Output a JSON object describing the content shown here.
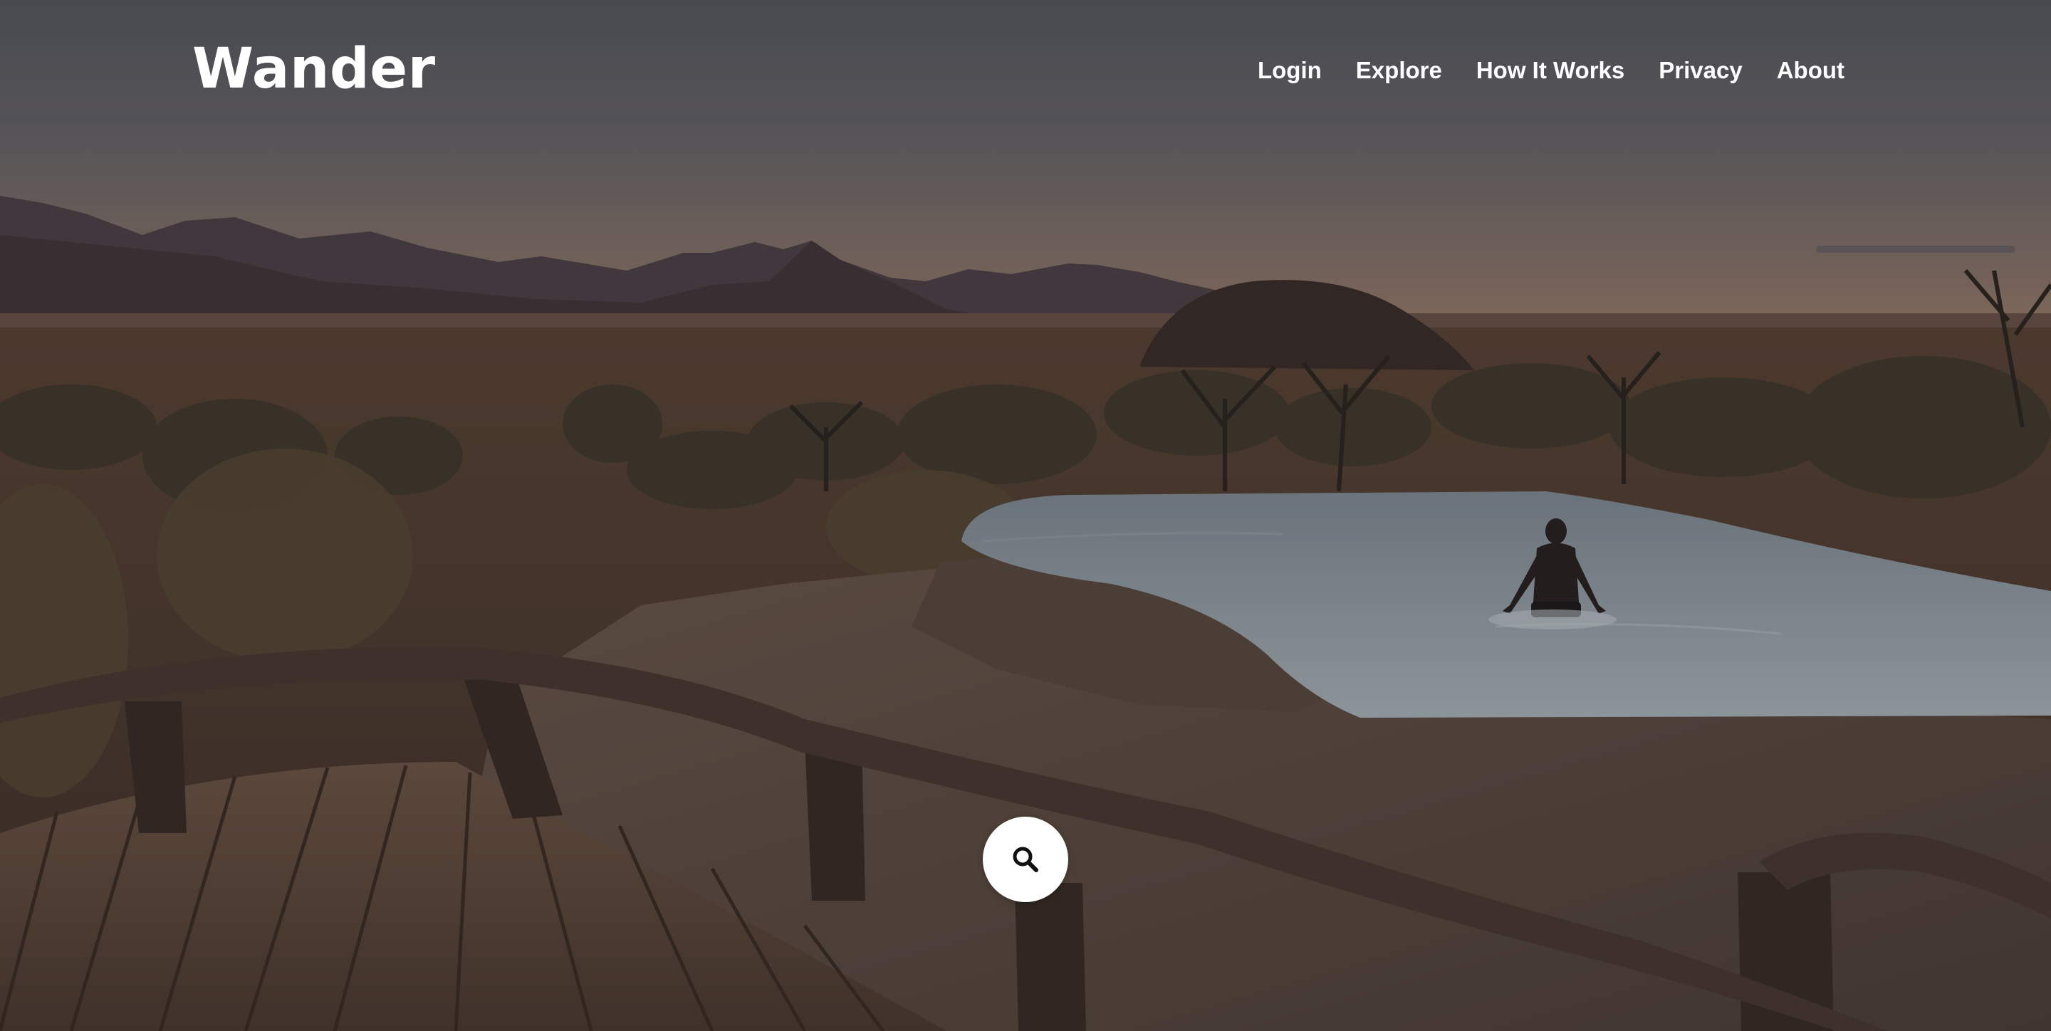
{
  "brand": {
    "name": "Wander"
  },
  "nav": {
    "items": [
      {
        "label": "Login",
        "name": "nav-login"
      },
      {
        "label": "Explore",
        "name": "nav-explore"
      },
      {
        "label": "How It Works",
        "name": "nav-how-it-works"
      },
      {
        "label": "Privacy",
        "name": "nav-privacy"
      },
      {
        "label": "About",
        "name": "nav-about"
      }
    ]
  },
  "search": {
    "icon": "search-icon"
  },
  "colors": {
    "text": "#ffffff",
    "search_bg": "#ffffff",
    "search_icon": "#111111"
  }
}
